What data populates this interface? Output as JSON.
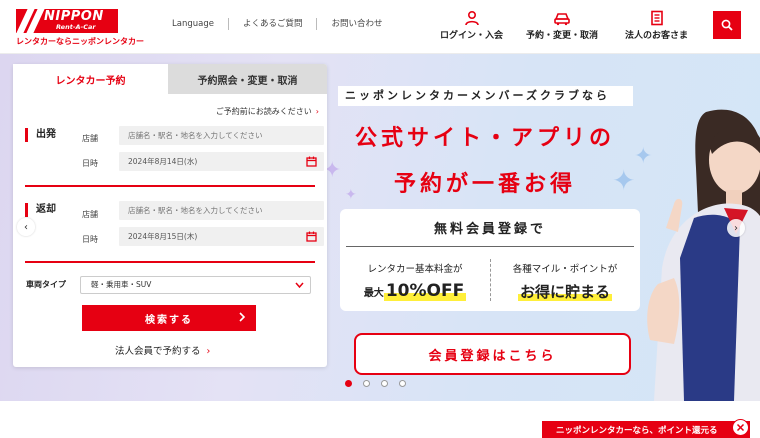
{
  "header": {
    "logo_main": "NIPPON",
    "logo_sub": "Rent-A-Car",
    "logo_tagline": "レンタカーならニッポンレンタカー",
    "links": [
      "Language",
      "よくあるご質問",
      "お問い合わせ"
    ],
    "nav": {
      "login": "ログイン・入会",
      "reserve": "予約・変更・取消",
      "corporate": "法人のお客さま"
    }
  },
  "booking": {
    "tab_active": "レンタカー予約",
    "tab_inactive": "予約照会・変更・取消",
    "notice": "ご予約前にお読みください",
    "departure": {
      "title": "出発",
      "store_label": "店舗",
      "store_placeholder": "店舗名・駅名・地名を入力してください",
      "date_label": "日時",
      "date_value": "2024年8月14日(水)"
    },
    "return": {
      "title": "返却",
      "store_label": "店舗",
      "store_placeholder": "店舗名・駅名・地名を入力してください",
      "date_label": "日時",
      "date_value": "2024年8月15日(木)"
    },
    "vehicle_label": "車両タイプ",
    "vehicle_value": "軽・乗用車・SUV",
    "submit": "検索する",
    "corporate_link": "法人会員で予約する"
  },
  "promo": {
    "headline": "ニッポンレンタカーメンバーズクラブなら",
    "line1": "公式サイト・アプリの",
    "line2": "予約が一番お得",
    "member_title": "無料会員登録で",
    "left_label": "レンタカー基本料金が",
    "left_pre": "最大",
    "left_value": "10%OFF",
    "right_label": "各種マイル・ポイントが",
    "right_value": "お得に貯まる",
    "register_button": "会員登録はこちら"
  },
  "carousel": {
    "slide_count": 4,
    "active_index": 0
  },
  "bottom_banner": "ニッポンレンタカーなら、ポイント還元る",
  "colors": {
    "brand_red": "#e60012",
    "highlight_yellow": "#ffef3a",
    "hero_bg": "#dde0f4"
  }
}
